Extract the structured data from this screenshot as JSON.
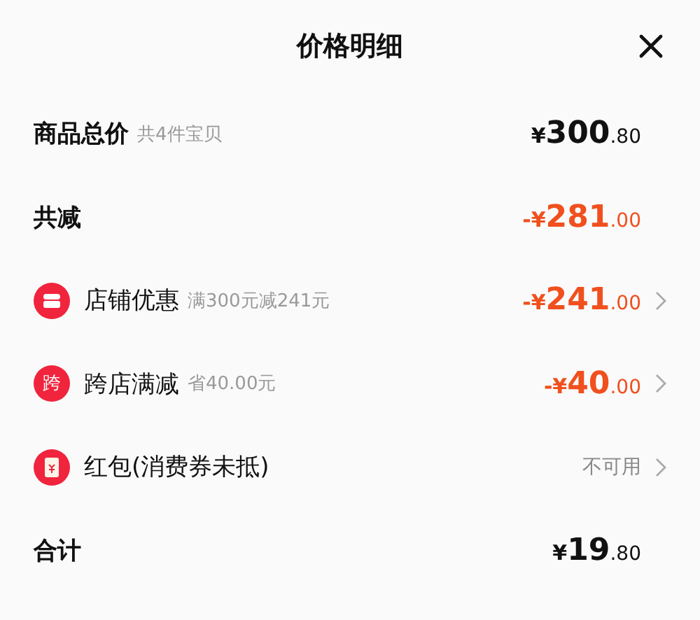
{
  "title": "价格明细",
  "rows": [
    {
      "kind": "plain",
      "label": "商品总价",
      "note": "共4件宝贝",
      "amount": {
        "kind": "normal",
        "prefix": "¥",
        "whole": "300",
        "cents": ".80"
      }
    },
    {
      "kind": "plain",
      "label": "共减",
      "amount": {
        "kind": "discount",
        "prefix": "-¥",
        "whole": "281",
        "cents": ".00"
      }
    },
    {
      "kind": "link",
      "icon": {
        "kind": "shop"
      },
      "label": "店铺优惠",
      "note": "满300元减241元",
      "amount": {
        "kind": "discount",
        "prefix": "-¥",
        "whole": "241",
        "cents": ".00"
      }
    },
    {
      "kind": "link",
      "icon": {
        "kind": "glyph",
        "text": "跨"
      },
      "label": "跨店满减",
      "note": "省40.00元",
      "amount": {
        "kind": "discount",
        "prefix": "-¥",
        "whole": "40",
        "cents": ".00"
      }
    },
    {
      "kind": "link",
      "icon": {
        "kind": "envelope"
      },
      "label": "红包(消费券未抵)",
      "status": "不可用"
    },
    {
      "kind": "plain",
      "label": "合计",
      "amount": {
        "kind": "normal",
        "prefix": "¥",
        "whole": "19",
        "cents": ".80"
      }
    }
  ]
}
